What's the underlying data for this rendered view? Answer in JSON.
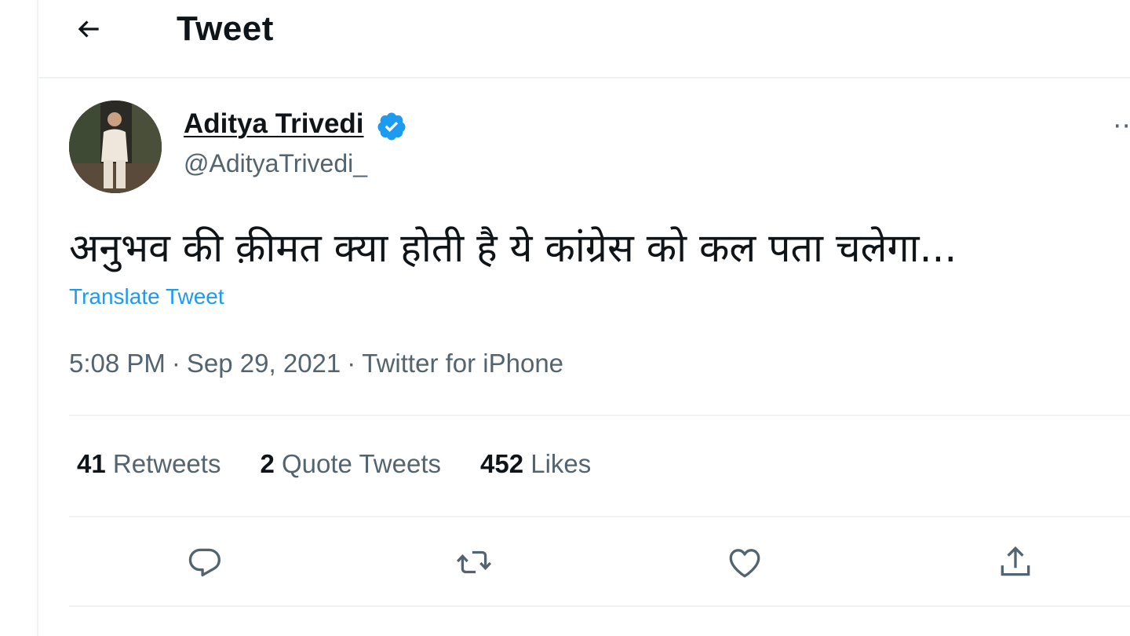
{
  "header": {
    "title": "Tweet",
    "back_icon": "arrow-left-icon"
  },
  "author": {
    "name": "Aditya Trivedi",
    "handle": "@AdityaTrivedi_",
    "verified": true,
    "verified_color": "#1d9bf0"
  },
  "tweet": {
    "text": "अनुभव की क़ीमत क्या होती है ये कांग्रेस को कल पता चलेगा...",
    "translate_label": "Translate Tweet",
    "time": "5:08 PM",
    "date": "Sep 29, 2021",
    "source": "Twitter for iPhone",
    "separator": "·"
  },
  "stats": [
    {
      "count": "41",
      "label": "Retweets"
    },
    {
      "count": "2",
      "label": "Quote Tweets"
    },
    {
      "count": "452",
      "label": "Likes"
    }
  ],
  "actions": [
    "reply-icon",
    "retweet-icon",
    "like-icon",
    "share-icon"
  ],
  "colors": {
    "accent": "#1d9bf0",
    "text_primary": "#0f1419",
    "text_secondary": "#536471",
    "border": "#eff3f4"
  }
}
